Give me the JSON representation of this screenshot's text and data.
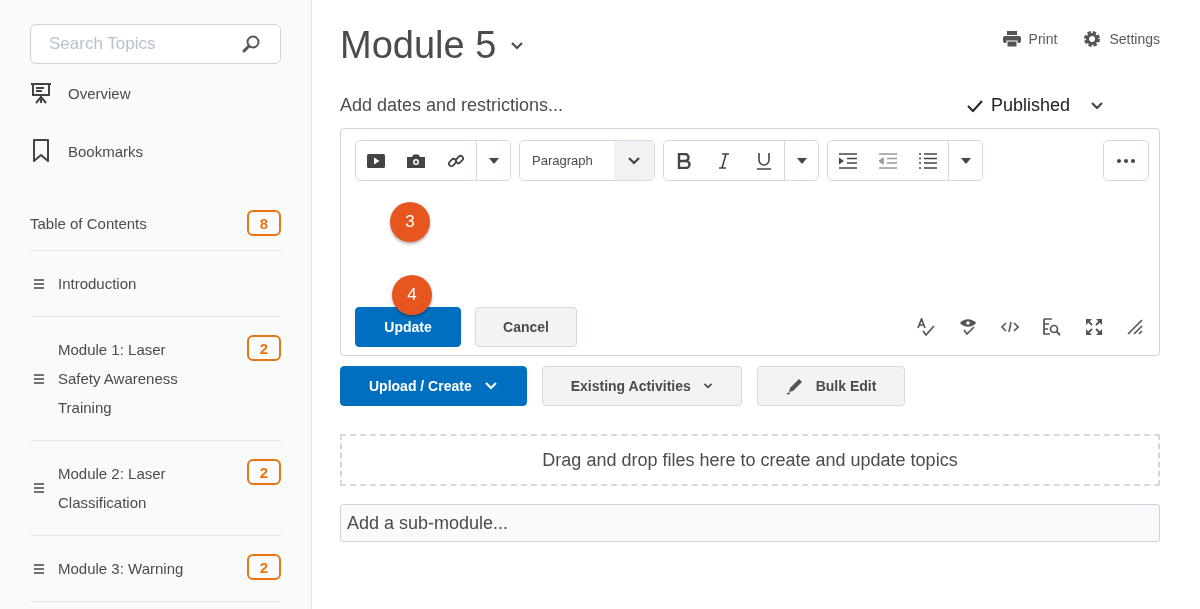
{
  "sidebar": {
    "search": {
      "placeholder": "Search Topics"
    },
    "nav": [
      {
        "kind": "overview",
        "label": "Overview"
      },
      {
        "kind": "bookmarks",
        "label": "Bookmarks"
      }
    ],
    "toc": {
      "title": "Table of Contents",
      "count": "8"
    },
    "items": [
      {
        "title": "Introduction"
      },
      {
        "title": "Module 1: Laser Safety Awareness Training",
        "count": "2"
      },
      {
        "title": "Module 2: Laser Classification",
        "count": "2"
      },
      {
        "title": "Module 3: Warning",
        "count": "2"
      }
    ]
  },
  "header": {
    "title": "Module 5",
    "actions": [
      {
        "kind": "print",
        "label": "Print"
      },
      {
        "kind": "settings",
        "label": "Settings"
      }
    ]
  },
  "dates_link": "Add dates and restrictions...",
  "status": {
    "label": "Published",
    "published": true
  },
  "editor": {
    "format": "Paragraph",
    "callouts": [
      "3",
      "4"
    ],
    "buttons": [
      {
        "kind": "primary",
        "label": "Update"
      },
      {
        "kind": "secondary",
        "label": "Cancel"
      }
    ]
  },
  "actions": [
    {
      "kind": "primary",
      "label": "Upload / Create"
    },
    {
      "kind": "dropdown",
      "label": "Existing Activities"
    },
    {
      "kind": "icon",
      "label": "Bulk Edit"
    }
  ],
  "dropzone": "Drag and drop files here to create and update topics",
  "submodule": {
    "placeholder": "Add a sub-module..."
  }
}
